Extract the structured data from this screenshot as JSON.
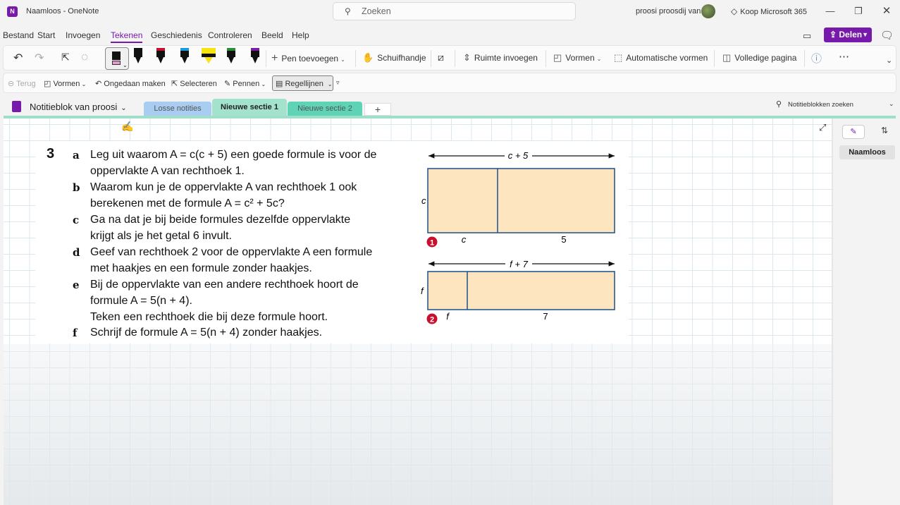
{
  "window": {
    "title": "Naamloos  -  OneNote",
    "search_placeholder": "Zoeken",
    "user_name": "proosi proosdij van",
    "buy_label": "Koop Microsoft 365"
  },
  "menu": [
    "Bestand",
    "Start",
    "Invoegen",
    "Tekenen",
    "Geschiedenis",
    "Controleren",
    "Beeld",
    "Help"
  ],
  "share_label": "Delen",
  "ribbon": {
    "add_pen": "Pen toevoegen",
    "lasso": "Schuifhandje",
    "insert_space": "Ruimte invoegen",
    "shapes": "Vormen",
    "auto_shapes": "Automatische vormen",
    "full_page": "Volledige pagina",
    "pen_colors": [
      "#111111",
      "#c8102e",
      "#1a9bd7",
      "#f6e30f",
      "#2e8b3a",
      "#7b1fa2"
    ]
  },
  "ribbon2": {
    "back": "Terug",
    "shapes": "Vormen",
    "undo": "Ongedaan maken",
    "select": "Selecteren",
    "pens": "Pennen",
    "rule_lines": "Regellijnen"
  },
  "notebook": {
    "name": "Notitieblok van proosi",
    "sections": [
      {
        "label": "Losse notities",
        "color": "#a9cdf0"
      },
      {
        "label": "Nieuwe sectie 1",
        "color": "#a3e2cc"
      },
      {
        "label": "Nieuwe sectie 2",
        "color": "#5fd3b6"
      }
    ],
    "add_tab": "+",
    "search_label": "Notitieblokken zoeken"
  },
  "pages": {
    "current": "Naamloos"
  },
  "exercise": {
    "number": "3",
    "items": [
      {
        "letter": "a",
        "lines": [
          "Leg uit waarom A = c(c + 5) een goede formule is voor de",
          "oppervlakte A van rechthoek 1."
        ]
      },
      {
        "letter": "b",
        "lines": [
          "Waarom kun je de oppervlakte A van rechthoek 1 ook",
          "berekenen met de formule A = c² + 5c?"
        ]
      },
      {
        "letter": "c",
        "lines": [
          "Ga na dat je bij beide formules dezelfde oppervlakte",
          "krijgt als je het getal 6 invult."
        ]
      },
      {
        "letter": "d",
        "lines": [
          "Geef van rechthoek 2 voor de oppervlakte A een formule",
          "met haakjes en een formule zonder haakjes."
        ]
      },
      {
        "letter": "e",
        "lines": [
          "Bij de oppervlakte van een andere rechthoek hoort de",
          "formule A = 5(n + 4).",
          "Teken een rechthoek die bij deze formule hoort."
        ]
      },
      {
        "letter": "f",
        "lines": [
          "Schrijf de formule A = 5(n + 4) zonder haakjes."
        ]
      }
    ]
  },
  "figures": {
    "rect1": {
      "number": "1",
      "top_label": "c + 5",
      "side_label": "c",
      "bottom_left": "c",
      "bottom_right": "5"
    },
    "rect2": {
      "number": "2",
      "top_label": "f + 7",
      "side_label": "f",
      "bottom_left": "f",
      "bottom_right": "7"
    },
    "fill_color": "#fde5c0",
    "stroke_color": "#1b4f8a",
    "badge_color": "#c8102e"
  }
}
